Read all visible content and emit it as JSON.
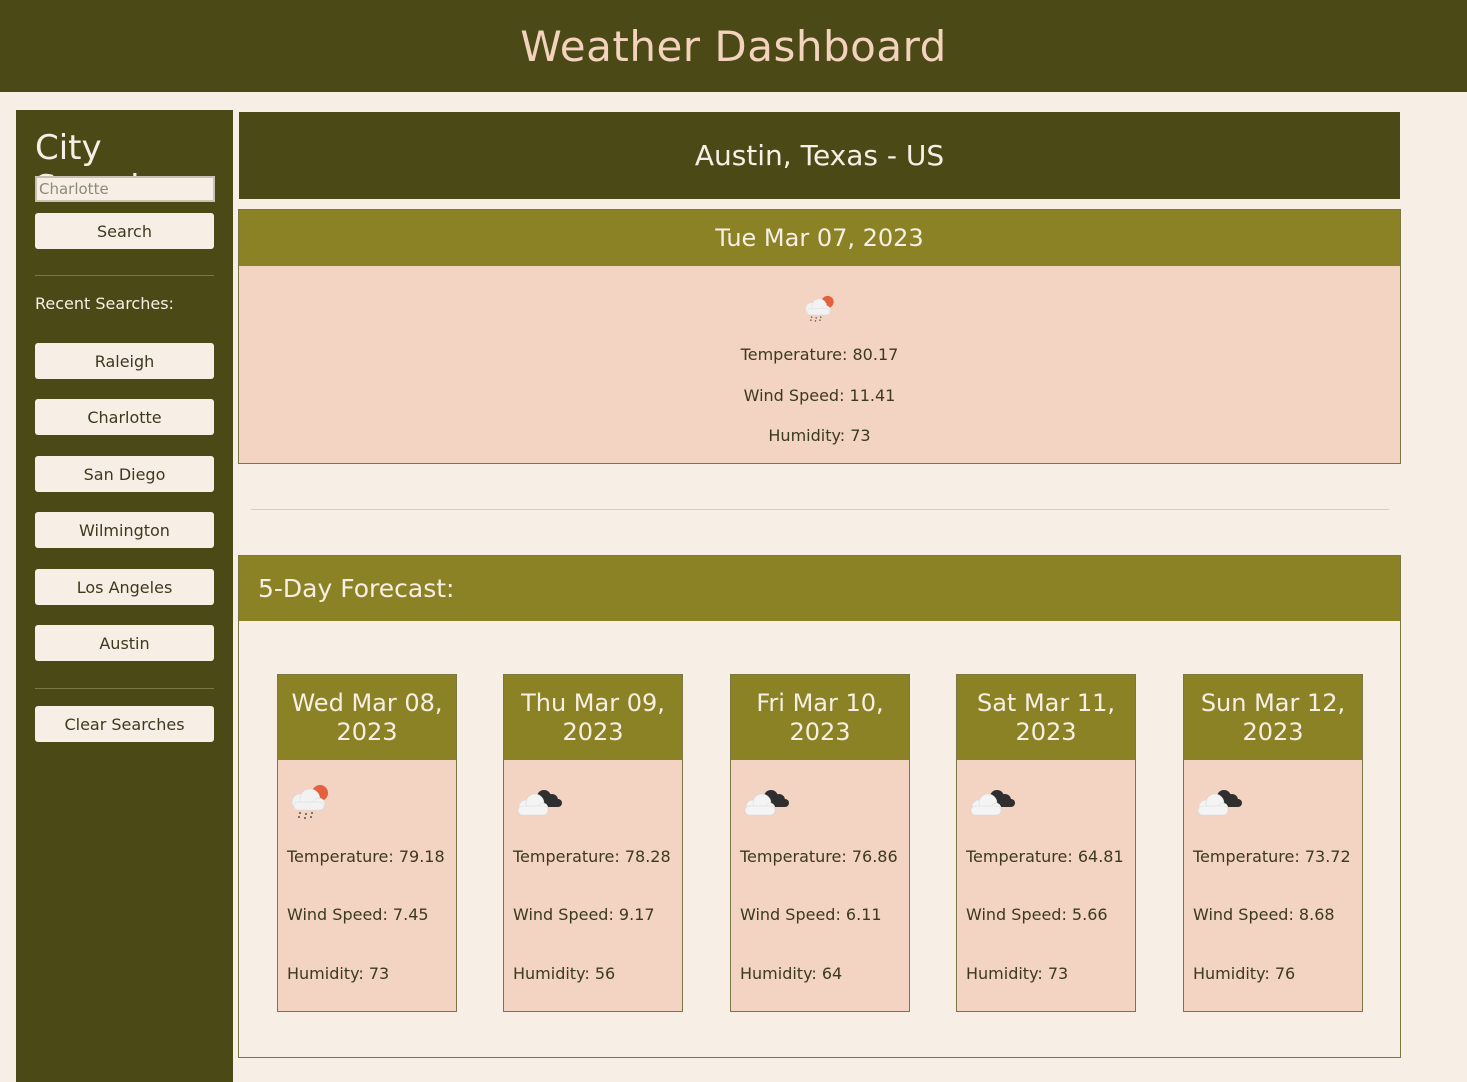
{
  "header": {
    "title": "Weather Dashboard"
  },
  "sidebar": {
    "title": "City Search:",
    "search_value": "Charlotte",
    "search_button": "Search",
    "recent_label": "Recent Searches:",
    "recent": [
      "Raleigh",
      "Charlotte",
      "San Diego",
      "Wilmington",
      "Los Angeles",
      "Austin"
    ],
    "clear_button": "Clear Searches"
  },
  "current": {
    "city": "Austin, Texas - US",
    "date": "Tue Mar 07, 2023",
    "icon": "rain-sun-icon",
    "temperature": "Temperature: 80.17",
    "wind": "Wind Speed: 11.41",
    "humidity": "Humidity: 73"
  },
  "forecast": {
    "title": "5-Day Forecast:",
    "days": [
      {
        "date": "Wed Mar 08, 2023",
        "icon": "rain-sun-icon",
        "temperature": "Temperature: 79.18",
        "wind": "Wind Speed: 7.45",
        "humidity": "Humidity: 73"
      },
      {
        "date": "Thu Mar 09, 2023",
        "icon": "clouds-icon",
        "temperature": "Temperature: 78.28",
        "wind": "Wind Speed: 9.17",
        "humidity": "Humidity: 56"
      },
      {
        "date": "Fri Mar 10, 2023",
        "icon": "clouds-icon",
        "temperature": "Temperature: 76.86",
        "wind": "Wind Speed: 6.11",
        "humidity": "Humidity: 64"
      },
      {
        "date": "Sat Mar 11, 2023",
        "icon": "clouds-icon",
        "temperature": "Temperature: 64.81",
        "wind": "Wind Speed: 5.66",
        "humidity": "Humidity: 73"
      },
      {
        "date": "Sun Mar 12, 2023",
        "icon": "clouds-icon",
        "temperature": "Temperature: 73.72",
        "wind": "Wind Speed: 8.68",
        "humidity": "Humidity: 76"
      }
    ]
  },
  "colors": {
    "dark_olive": "#4b4a17",
    "olive": "#8a8224",
    "peach": "#f3d3c1",
    "cream": "#f7efe5",
    "title_peach": "#f3d3bd"
  }
}
